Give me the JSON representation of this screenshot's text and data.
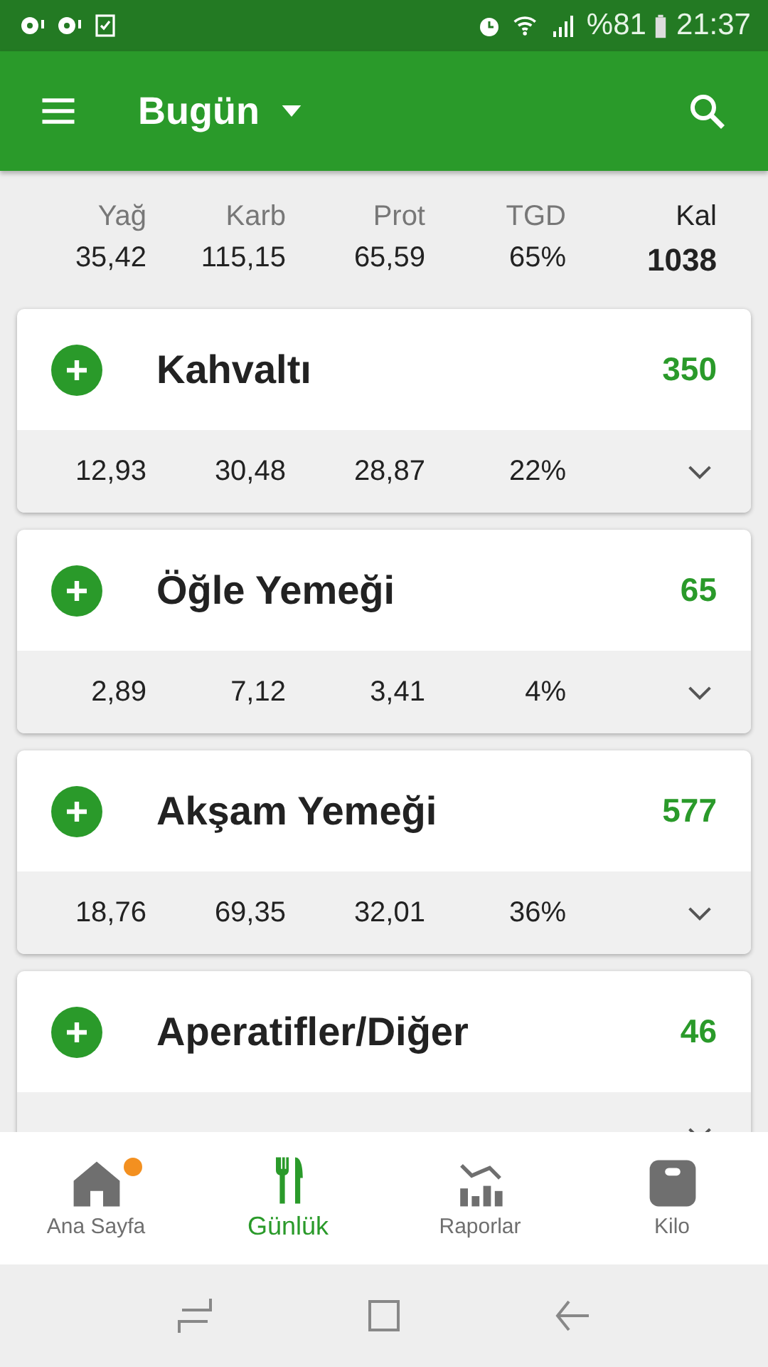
{
  "status_bar": {
    "battery": "%81",
    "time": "21:37"
  },
  "toolbar": {
    "title": "Bugün"
  },
  "summary": {
    "columns": [
      {
        "label": "Yağ",
        "value": "35,42"
      },
      {
        "label": "Karb",
        "value": "115,15"
      },
      {
        "label": "Prot",
        "value": "65,59"
      },
      {
        "label": "TGD",
        "value": "65%"
      }
    ],
    "total": {
      "label": "Kal",
      "value": "1038"
    }
  },
  "meals": [
    {
      "name": "Kahvaltı",
      "calories": "350",
      "stats": [
        "12,93",
        "30,48",
        "28,87",
        "22%"
      ],
      "expanded": false
    },
    {
      "name": "Öğle Yemeği",
      "calories": "65",
      "stats": [
        "2,89",
        "7,12",
        "3,41",
        "4%"
      ],
      "expanded": false
    },
    {
      "name": "Akşam Yemeği",
      "calories": "577",
      "stats": [
        "18,76",
        "69,35",
        "32,01",
        "36%"
      ],
      "expanded": false
    },
    {
      "name": "Aperatifler/Diğer",
      "calories": "46",
      "expanded": false
    }
  ],
  "bottom_nav": [
    {
      "kind": "home",
      "label": "Ana Sayfa",
      "selected": false,
      "badge": true
    },
    {
      "kind": "diary",
      "label": "Günlük",
      "selected": true,
      "badge": false
    },
    {
      "kind": "reports",
      "label": "Raporlar",
      "selected": false,
      "badge": false
    },
    {
      "kind": "scale",
      "label": "Kilo",
      "selected": false,
      "badge": false
    }
  ]
}
